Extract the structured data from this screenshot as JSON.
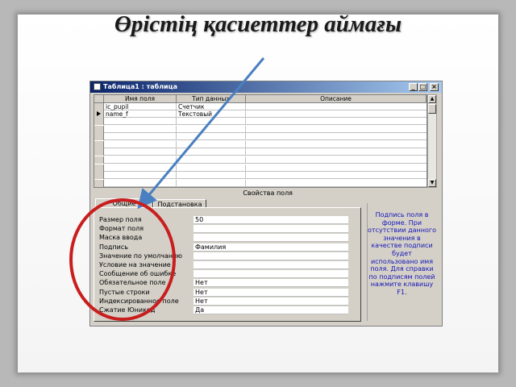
{
  "slide": {
    "title": "Өрістің қасиеттер аймағы"
  },
  "window": {
    "title": "Таблица1 : таблица",
    "buttons": {
      "minimize": "_",
      "maximize": "□",
      "close": "×"
    }
  },
  "grid": {
    "columns": [
      "Имя поля",
      "Тип данных",
      "Описание"
    ],
    "rows": [
      {
        "name": "ic_pupil",
        "type": "Счетчик",
        "description": ""
      },
      {
        "name": "name_f",
        "type": "Текстовый",
        "description": ""
      }
    ],
    "current_row_marker": "▶"
  },
  "properties": {
    "section_label": "Свойства поля",
    "tabs": [
      "Общие",
      "Подстановка"
    ],
    "active_tab": "Общие",
    "fields": [
      {
        "label": "Размер поля",
        "value": "50"
      },
      {
        "label": "Формат поля",
        "value": ""
      },
      {
        "label": "Маска ввода",
        "value": ""
      },
      {
        "label": "Подпись",
        "value": "Фамилия"
      },
      {
        "label": "Значение по умолчанию",
        "value": ""
      },
      {
        "label": "Условие на значение",
        "value": ""
      },
      {
        "label": "Сообщение об ошибке",
        "value": ""
      },
      {
        "label": "Обязательное поле",
        "value": "Нет"
      },
      {
        "label": "Пустые строки",
        "value": "Нет"
      },
      {
        "label": "Индексированное поле",
        "value": "Нет"
      },
      {
        "label": "Сжатие Юникод",
        "value": "Да"
      }
    ],
    "help_text": "Подпись поля в форме. При отсутствии данного значения в качестве подписи будет использовано имя поля. Для справки по подписям полей нажмите клавишу F1."
  },
  "colors": {
    "annotation_arrow": "#4a7fc1",
    "annotation_circle": "#c81e1e",
    "help_text": "#1515b5"
  }
}
